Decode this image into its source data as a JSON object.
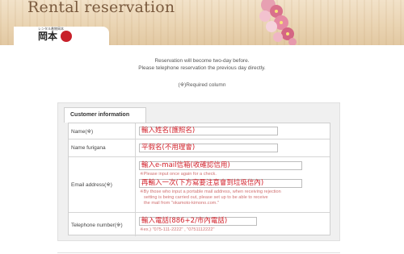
{
  "header": {
    "title": "Rental reservation",
    "logo_text": "岡本",
    "logo_subtext": "レンタル着物岡本"
  },
  "notes": {
    "line1": "Reservation will become two-day before.",
    "line2": "Please telephone reservation the previous day directly.",
    "required": "(※)Required column"
  },
  "form": {
    "section_tab": "Customer information",
    "rows": [
      {
        "label": "Name(※)",
        "overlay": "輸入姓名(護照名)"
      },
      {
        "label": "Name furigana",
        "overlay": "平假名(不用理會)"
      },
      {
        "label": "Email address(※)",
        "overlay": "輸入e-mail信箱(收確認信用)",
        "hint1": "※Please input once again for a check.",
        "overlay2": "再輸入一次(下方寫要注意會到垃圾信內)",
        "hint2a": "※By those who input a portable mail address, when receiving rejection",
        "hint2b": "setting is being carried out, please set up to be able to receive",
        "hint2c": "the mail from \"okamoto-kimono.com.\""
      },
      {
        "label": "Telephone number(※)",
        "overlay": "輸入電話(886+2/市內電話)",
        "hint": "※ex.) \"075-111-2222\" , \"0751112222\""
      }
    ]
  },
  "colors": {
    "accent_red": "#d2202a",
    "banner": "#e9d3b1"
  }
}
